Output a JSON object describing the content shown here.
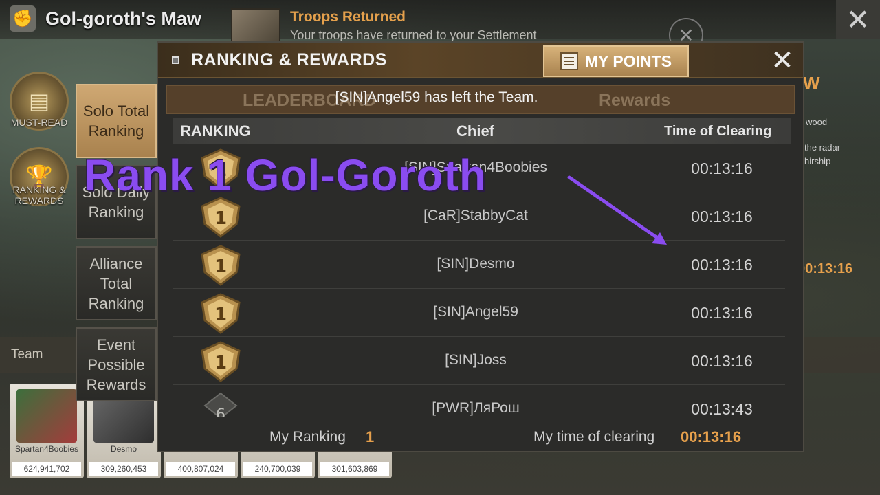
{
  "background": {
    "title": "Gol-goroth's Maw",
    "notification": {
      "title": "Troops Returned",
      "text": "Your troops have returned to your Settlement"
    },
    "side_buttons": [
      {
        "label": "MUST-READ",
        "icon": "book-icon"
      },
      {
        "label": "RANKING & REWARDS",
        "icon": "trophy-icon"
      }
    ],
    "team_label": "Team",
    "members": [
      {
        "name": "Spartan4Boobies",
        "power": "624,941,702"
      },
      {
        "name": "Desmo",
        "power": "309,260,453"
      },
      {
        "name": "",
        "power": "400,807,024"
      },
      {
        "name": "",
        "power": "240,700,039"
      },
      {
        "name": "",
        "power": "301,603,869"
      }
    ],
    "right_fragments": [
      "W",
      "wood",
      "the radar",
      "hirship",
      "00:13:16"
    ]
  },
  "tabs": [
    {
      "label": "Solo Total Ranking",
      "active": true
    },
    {
      "label": "Solo Daily Ranking",
      "active": false
    },
    {
      "label": "Alliance Total Ranking",
      "active": false
    },
    {
      "label": "Event Possible Rewards",
      "active": false
    }
  ],
  "panel": {
    "title": "RANKING & REWARDS",
    "my_points_label": "MY POINTS",
    "subtabs": [
      "LEADERBOARD",
      "Rewards"
    ],
    "toast": "[SIN]Angel59 has left the Team.",
    "columns": {
      "ranking": "RANKING",
      "chief": "Chief",
      "time": "Time of Clearing"
    },
    "rows": [
      {
        "rank": "1",
        "chief": "[SIN]Spartan4Boobies",
        "time": "00:13:16"
      },
      {
        "rank": "1",
        "chief": "[CaR]StabbyCat",
        "time": "00:13:16"
      },
      {
        "rank": "1",
        "chief": "[SIN]Desmo",
        "time": "00:13:16"
      },
      {
        "rank": "1",
        "chief": "[SIN]Angel59",
        "time": "00:13:16"
      },
      {
        "rank": "1",
        "chief": "[SIN]Joss",
        "time": "00:13:16"
      },
      {
        "rank": "6",
        "chief": "[PWR]ЛяРош",
        "time": "00:13:43"
      }
    ],
    "footer": {
      "my_ranking_label": "My Ranking",
      "my_ranking": "1",
      "my_time_label": "My time of clearing",
      "my_time": "00:13:16"
    }
  },
  "overlay": {
    "text": "Rank 1 Gol-Goroth",
    "color": "#8a4cf0"
  },
  "colors": {
    "accent": "#e6a04c",
    "header_brown": "#5b4427",
    "tab_active": "#c49d68"
  }
}
